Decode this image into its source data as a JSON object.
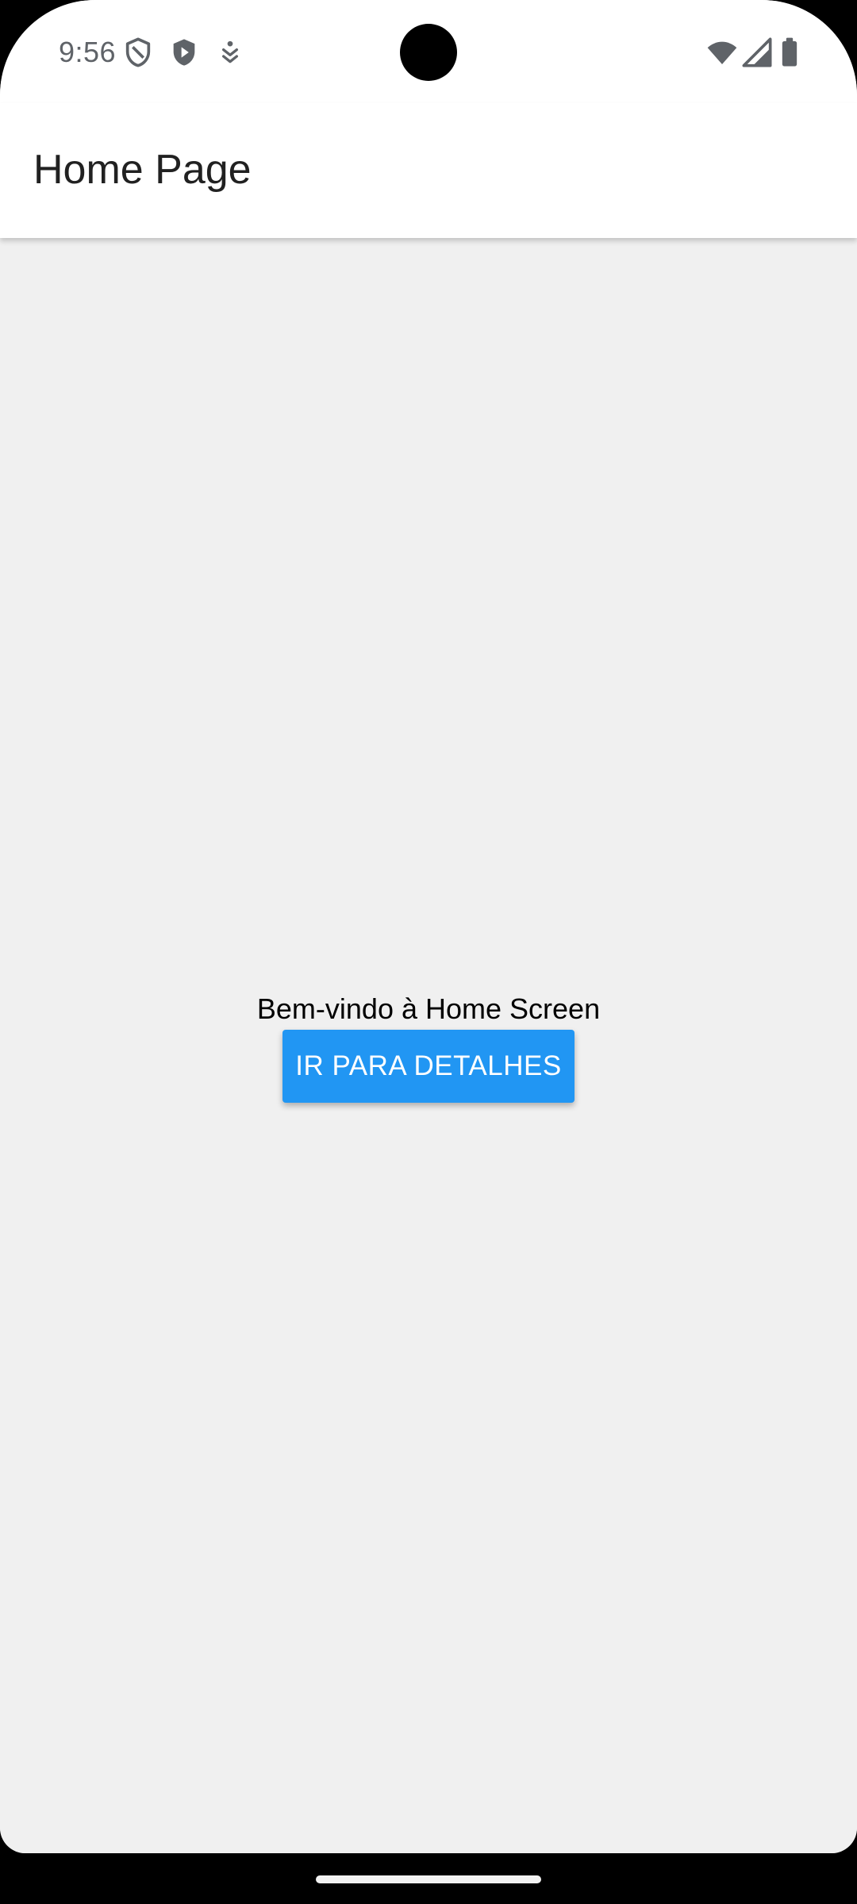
{
  "status_bar": {
    "time": "9:56",
    "left_icons": [
      "shield-outline-icon",
      "play-shield-icon",
      "accessibility-download-icon"
    ],
    "right_icons": [
      "wifi-icon",
      "cell-signal-icon",
      "battery-icon"
    ],
    "icon_color": "#5f6368"
  },
  "app_bar": {
    "title": "Home Page",
    "background": "#ffffff"
  },
  "main": {
    "welcome_text": "Bem-vindo à Home Screen",
    "button_label": "IR PARA DETALHES",
    "button_color": "#2196f3",
    "background": "#f0f0f0"
  },
  "system_nav": {
    "gesture_handle": "home-gesture-bar"
  }
}
